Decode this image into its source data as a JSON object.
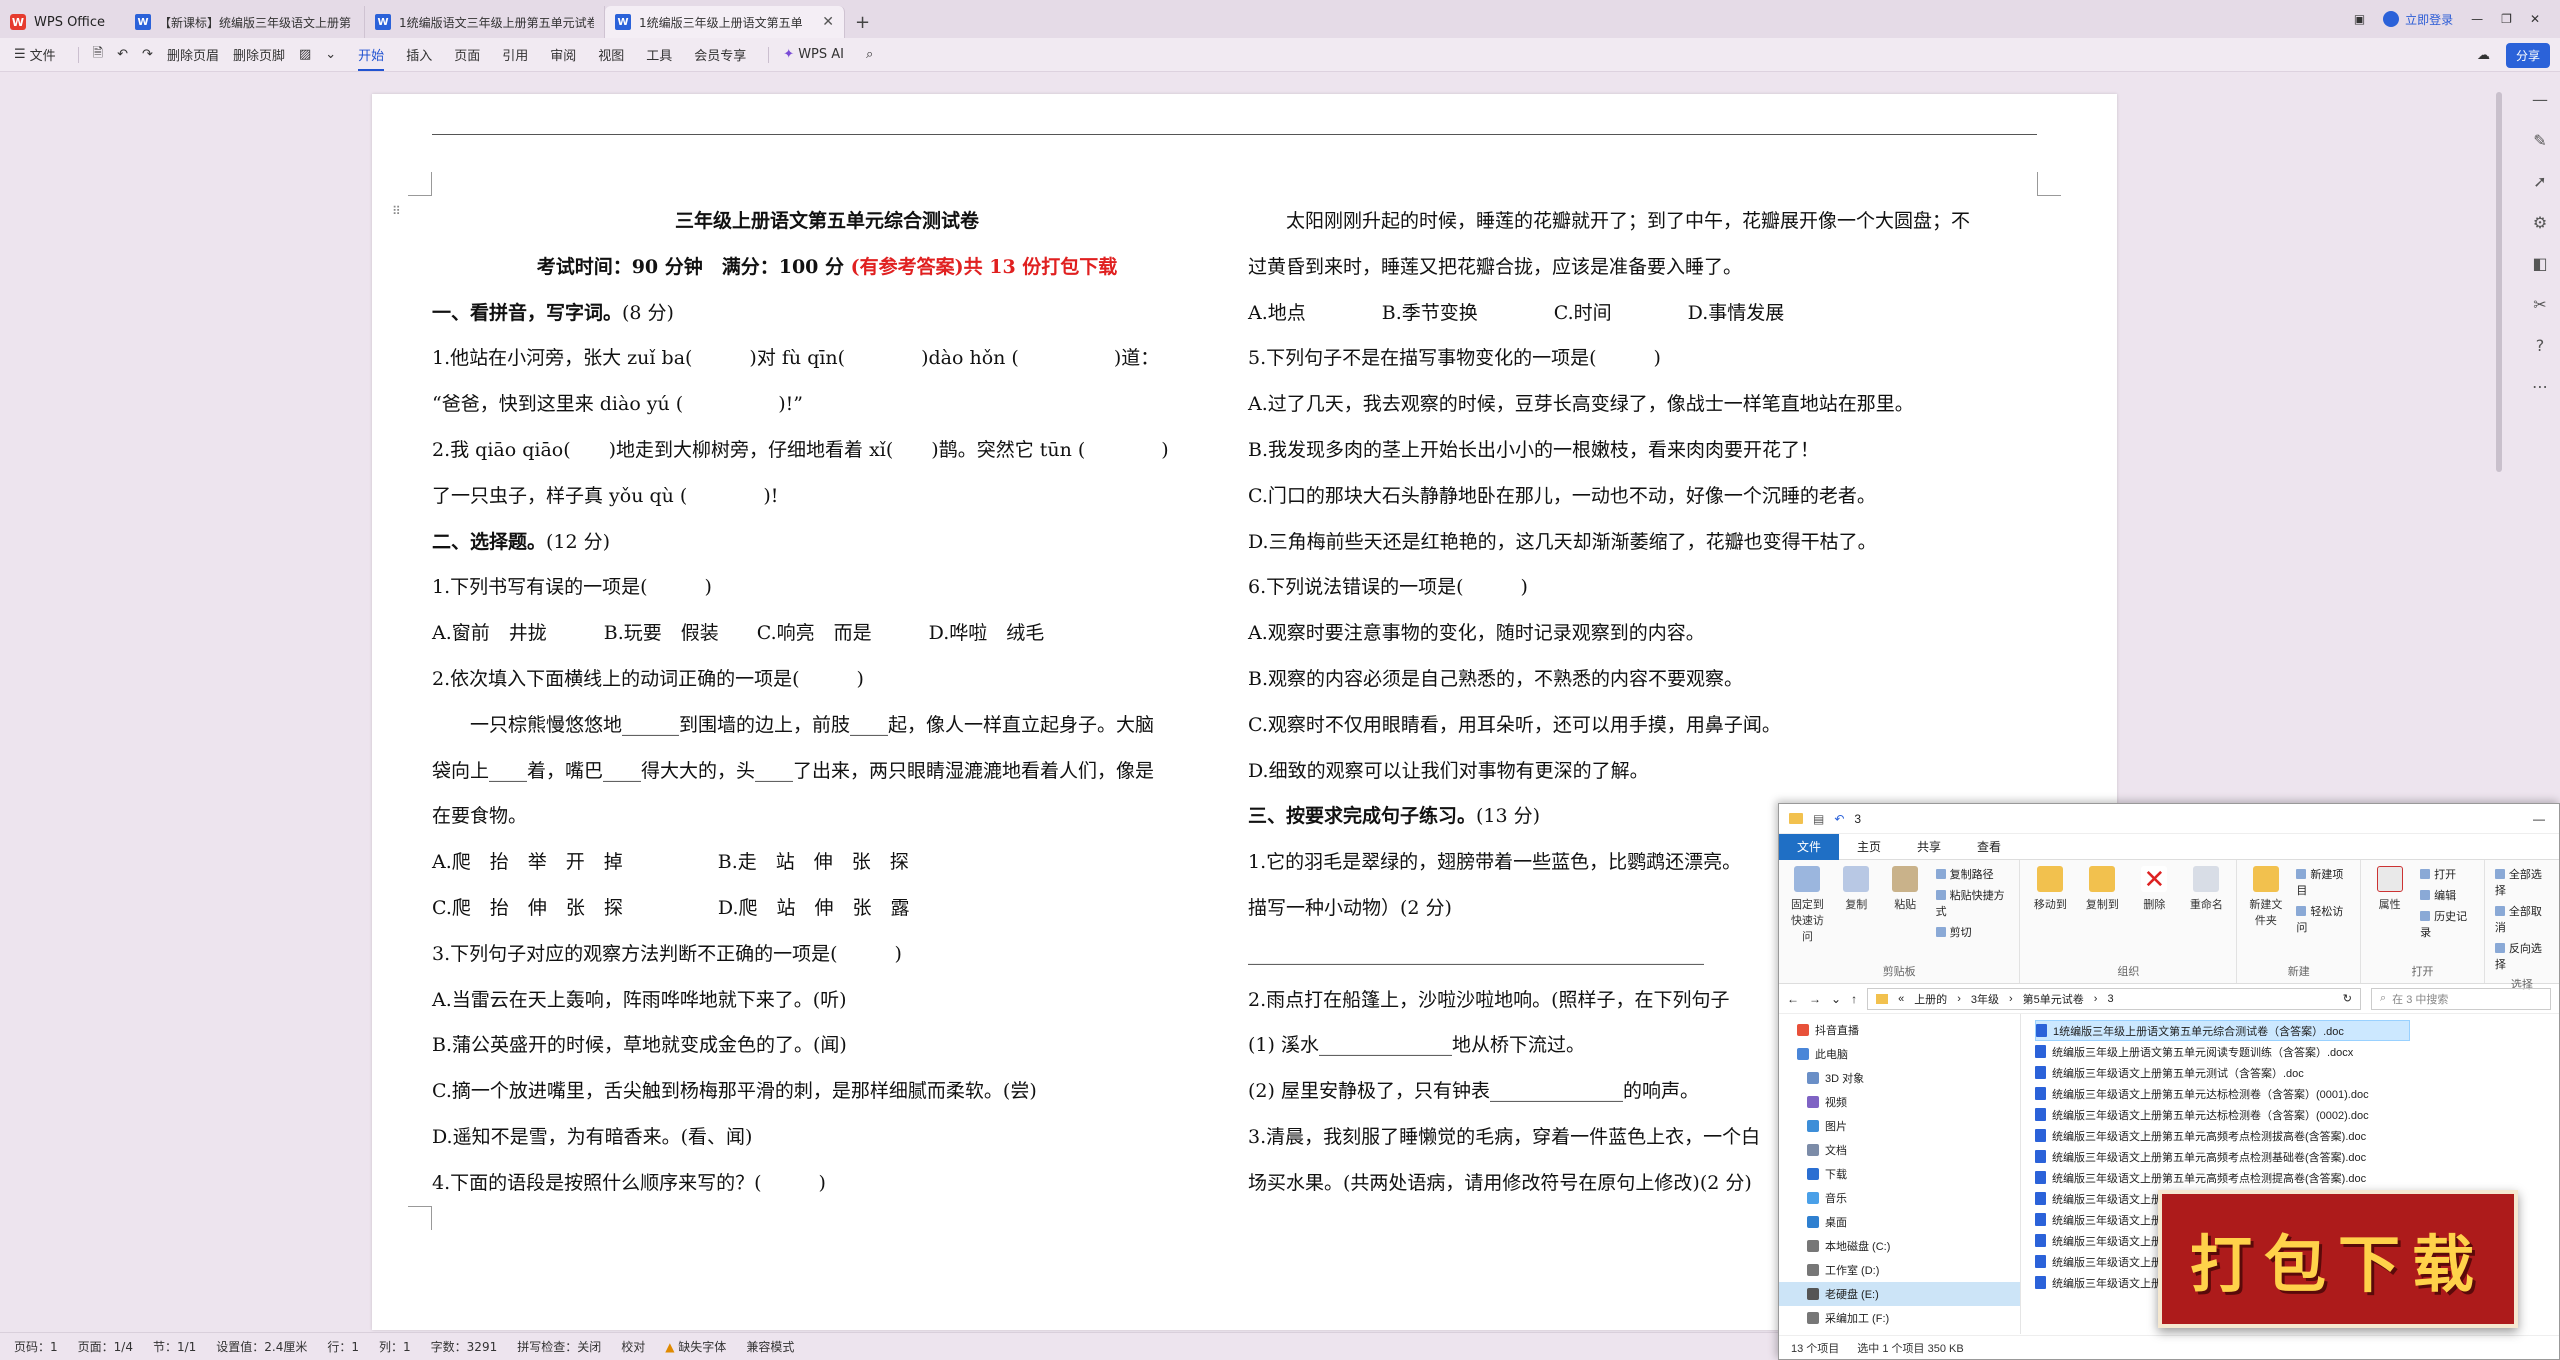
{
  "window": {
    "app_name": "WPS Office",
    "tabs": [
      {
        "label": "【新课标】统编版三年级语文上册第",
        "active": false
      },
      {
        "label": "1统编版语文三年级上册第五单元试卷",
        "active": false
      },
      {
        "label": "1统编版三年级上册语文第五单",
        "active": true
      }
    ],
    "new_tab": "+",
    "login_label": "立即登录"
  },
  "ribbon": {
    "file_menu": "文件",
    "delete_header": "删除页眉",
    "delete_footer": "删除页脚",
    "tabs": [
      "开始",
      "插入",
      "页面",
      "引用",
      "审阅",
      "视图",
      "工具",
      "会员专享"
    ],
    "active_tab": "开始",
    "wps_ai": "WPS AI",
    "share": "分享"
  },
  "document": {
    "title": "三年级上册语文第五单元综合测试卷",
    "subtitle_prefix": "考试时间：90 分钟　满分：100 分 ",
    "subtitle_red": "(有参考答案)共 13 份打包下载",
    "left": [
      {
        "text": "一、看拼音，写字词。",
        "suffix": "(8 分)",
        "bold": true
      },
      {
        "text": "1.他站在小河旁，张大 zuǐ ba(　　　)对 fù qīn(　　　　)dào hǒn (　　　　　)道："
      },
      {
        "text": "“爸爸，快到这里来 diào yú (　　　　　)!”"
      },
      {
        "text": "2.我 qiāo qiāo(　　)地走到大柳树旁，仔细地看着 xǐ(　　)鹊。突然它 tūn (　　　　)"
      },
      {
        "text": "了一只虫子，样子真 yǒu qù (　　　　)!"
      },
      {
        "text": "二、选择题。",
        "suffix": "(12 分)",
        "bold": true
      },
      {
        "text": "1.下列书写有误的一项是(　　　)"
      },
      {
        "text": "A.窗前　井拢　　　B.玩要　假装　　C.响亮　而是　　　D.哗啦　绒毛"
      },
      {
        "text": "2.依次填入下面横线上的动词正确的一项是(　　　)"
      },
      {
        "text": "一只棕熊慢悠悠地______到围墙的边上，前肢____起，像人一样直立起身子。大脑",
        "indent": true
      },
      {
        "text": "袋向上____着，嘴巴____得大大的，头____了出来，两只眼睛湿漉漉地看着人们，像是"
      },
      {
        "text": "在要食物。"
      },
      {
        "text": "A.爬　抬　举　开　掉　　　　　B.走　站　伸　张　探"
      },
      {
        "text": "C.爬　抬　伸　张　探　　　　　D.爬　站　伸　张　露"
      },
      {
        "text": "3.下列句子对应的观察方法判断不正确的一项是(　　　)"
      },
      {
        "text": "A.当雷云在天上轰响，阵雨哗哗地就下来了。(听)"
      },
      {
        "text": "B.蒲公英盛开的时候，草地就变成金色的了。(闻)"
      },
      {
        "text": "C.摘一个放进嘴里，舌尖触到杨梅那平滑的刺，是那样细腻而柔软。(尝)"
      },
      {
        "text": "D.遥知不是雪，为有暗香来。(看、闻)"
      },
      {
        "text": "4.下面的语段是按照什么顺序来写的？(　　　)"
      }
    ],
    "right": [
      {
        "text": "太阳刚刚升起的时候，睡莲的花瓣就开了；到了中午，花瓣展开像一个大圆盘；不",
        "indent": true
      },
      {
        "text": "过黄昏到来时，睡莲又把花瓣合拢，应该是准备要入睡了。"
      },
      {
        "text": "A.地点　　　　B.季节变换　　　　C.时间　　　　D.事情发展"
      },
      {
        "text": "5.下列句子不是在描写事物变化的一项是(　　　)"
      },
      {
        "text": "A.过了几天，我去观察的时候，豆芽长高变绿了，像战士一样笔直地站在那里。"
      },
      {
        "text": "B.我发现多肉的茎上开始长出小小的一根嫩枝，看来肉肉要开花了！"
      },
      {
        "text": "C.门口的那块大石头静静地卧在那儿，一动也不动，好像一个沉睡的老者。"
      },
      {
        "text": "D.三角梅前些天还是红艳艳的，这几天却渐渐萎缩了，花瓣也变得干枯了。"
      },
      {
        "text": "6.下列说法错误的一项是(　　　)"
      },
      {
        "text": "A.观察时要注意事物的变化，随时记录观察到的内容。"
      },
      {
        "text": "B.观察的内容必须是自己熟悉的，不熟悉的内容不要观察。"
      },
      {
        "text": "C.观察时不仅用眼睛看，用耳朵听，还可以用手摸，用鼻子闻。"
      },
      {
        "text": "D.细致的观察可以让我们对事物有更深的了解。"
      },
      {
        "text": "三、按要求完成句子练习。",
        "suffix": "(13 分)",
        "bold": true
      },
      {
        "text": "1.它的羽毛是翠绿的，翅膀带着一些蓝色，比鹦鹉还漂亮。"
      },
      {
        "text": "描写一种小动物）(2 分)"
      },
      {
        "text": "________________________________________________"
      },
      {
        "text": "2.雨点打在船篷上，沙啦沙啦地响。(照样子，在下列句子"
      },
      {
        "text": "(1) 溪水______________地从桥下流过。"
      },
      {
        "text": "(2) 屋里安静极了，只有钟表______________的响声。"
      },
      {
        "text": "3.清晨，我刻服了睡懒觉的毛病，穿着一件蓝色上衣，一个白"
      },
      {
        "text": "场买水果。(共两处语病，请用修改符号在原句上修改)(2 分)"
      }
    ]
  },
  "statusbar": {
    "page_no": "页码：1",
    "pages": "页面：1/4",
    "section": "节：1/1",
    "setting": "设置值：2.4厘米",
    "row": "行：1",
    "col": "列：1",
    "words": "字数：3291",
    "spell": "拼写检查：关闭",
    "proof": "校对",
    "missing_font": "缺失字体",
    "compat": "兼容模式"
  },
  "explorer": {
    "title": "3",
    "tabs": [
      "文件",
      "主页",
      "共享",
      "查看"
    ],
    "groups": [
      {
        "label": "剪贴板",
        "buttons": [
          "固定到快速访问",
          "复制",
          "粘贴"
        ],
        "small": [
          "复制路径",
          "粘贴快捷方式",
          "剪切"
        ]
      },
      {
        "label": "组织",
        "buttons": [
          "移动到",
          "复制到",
          "删除",
          "重命名"
        ],
        "small": []
      },
      {
        "label": "新建",
        "buttons": [
          "新建文件夹"
        ],
        "small": [
          "新建项目",
          "轻松访问"
        ]
      },
      {
        "label": "打开",
        "buttons": [
          "属性"
        ],
        "small": [
          "打开",
          "编辑",
          "历史记录"
        ]
      },
      {
        "label": "选择",
        "buttons": [],
        "small": [
          "全部选择",
          "全部取消",
          "反向选择"
        ]
      }
    ],
    "breadcrumb": [
      "上册的",
      "3年级",
      "第5单元试卷",
      "3"
    ],
    "search_placeholder": "在 3 中搜索",
    "nav": [
      {
        "label": "抖音直播",
        "top": true
      },
      {
        "label": "此电脑",
        "top": true
      },
      {
        "label": "3D 对象"
      },
      {
        "label": "视频"
      },
      {
        "label": "图片"
      },
      {
        "label": "文档"
      },
      {
        "label": "下载"
      },
      {
        "label": "音乐"
      },
      {
        "label": "桌面"
      },
      {
        "label": "本地磁盘 (C:)"
      },
      {
        "label": "工作室 (D:)"
      },
      {
        "label": "老硬盘 (E:)",
        "selected": true
      },
      {
        "label": "采编加工 (F:)"
      }
    ],
    "files": [
      {
        "name": "1统编版三年级上册语文第五单元综合测试卷（含答案）.doc",
        "selected": true
      },
      {
        "name": "统编版三年级上册语文第五单元阅读专题训练（含答案）.docx"
      },
      {
        "name": "统编版三年级语文上册第五单元测试（含答案）.doc"
      },
      {
        "name": "统编版三年级语文上册第五单元达标检测卷（含答案）(0001).doc"
      },
      {
        "name": "统编版三年级语文上册第五单元达标检测卷（含答案）(0002).doc"
      },
      {
        "name": "统编版三年级语文上册第五单元高频考点检测拔高卷(含答案).doc"
      },
      {
        "name": "统编版三年级语文上册第五单元高频考点检测基础卷(含答案).doc"
      },
      {
        "name": "统编版三年级语文上册第五单元高频考点检测提高卷(含答案).doc"
      },
      {
        "name": "统编版三年级语文上册第五单元"
      },
      {
        "name": "统编版三年级语文上册第五单元"
      },
      {
        "name": "统编版三年级语文上册第五单元"
      },
      {
        "name": "统编版三年级语文上册第五单元"
      },
      {
        "name": "统编版三年级语文上册第五单元"
      }
    ],
    "status_count": "13 个项目",
    "status_selected": "选中 1 个项目  350 KB"
  },
  "badge": {
    "text": "打包下载"
  },
  "colors": {
    "accent": "#2254d1",
    "red": "#e02020",
    "badge": "#ad1b1b",
    "badge_text": "#ffd24a"
  }
}
